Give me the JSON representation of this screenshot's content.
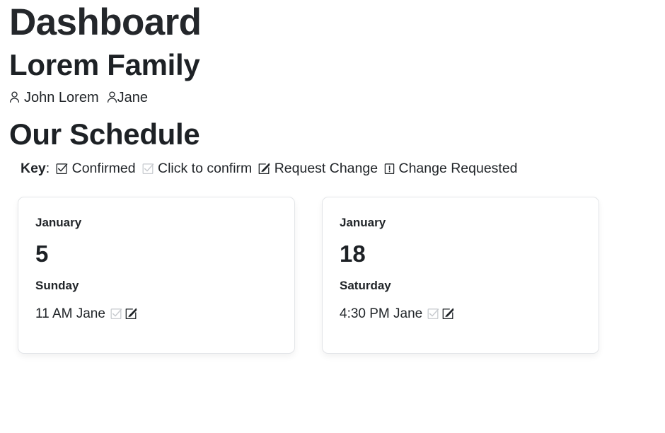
{
  "page": {
    "title": "Dashboard",
    "family_title": "Lorem Family",
    "section_title": "Our Schedule"
  },
  "members": [
    {
      "icon": "person-icon",
      "glyph": "☹",
      "name": "John Lorem",
      "spacer": " "
    },
    {
      "icon": "person-icon",
      "glyph": "☹",
      "name": "Jane",
      "spacer": ""
    }
  ],
  "key": {
    "label": "Key",
    "colon": ":",
    "items": [
      {
        "icon": "checkbox-checked-icon",
        "glyph": "☑",
        "tone": "dark",
        "label": "Confirmed"
      },
      {
        "icon": "checkbox-unchecked-icon",
        "glyph": "☑",
        "tone": "muted",
        "label": "Click to confirm"
      },
      {
        "icon": "pencil-square-icon",
        "glyph": "🗒",
        "tone": "dark",
        "label": "Request Change"
      },
      {
        "icon": "exclamation-box-icon",
        "glyph": "❕",
        "tone": "dark",
        "label": "Change Requested"
      }
    ]
  },
  "cards": [
    {
      "month": "January",
      "day_number": "5",
      "weekday": "Sunday",
      "entry": {
        "text": "11 AM Jane",
        "time": "11 AM",
        "person": "Jane",
        "confirm_icon": "checkbox-unchecked-icon",
        "confirm_glyph": "☑",
        "confirm_tone": "muted",
        "edit_icon": "pencil-square-icon",
        "edit_glyph": "🗒",
        "edit_tone": "dark"
      }
    },
    {
      "month": "January",
      "day_number": "18",
      "weekday": "Saturday",
      "entry": {
        "text": "4:30 PM Jane",
        "time": "4:30 PM",
        "person": "Jane",
        "confirm_icon": "checkbox-unchecked-icon",
        "confirm_glyph": "☑",
        "confirm_tone": "muted",
        "edit_icon": "pencil-square-icon",
        "edit_glyph": "🗒",
        "edit_tone": "dark"
      }
    }
  ],
  "colors": {
    "text": "#212529",
    "heading": "#1d2125",
    "muted_icon": "#c9ccd0",
    "card_border": "#e3e5e8",
    "background": "#ffffff"
  }
}
